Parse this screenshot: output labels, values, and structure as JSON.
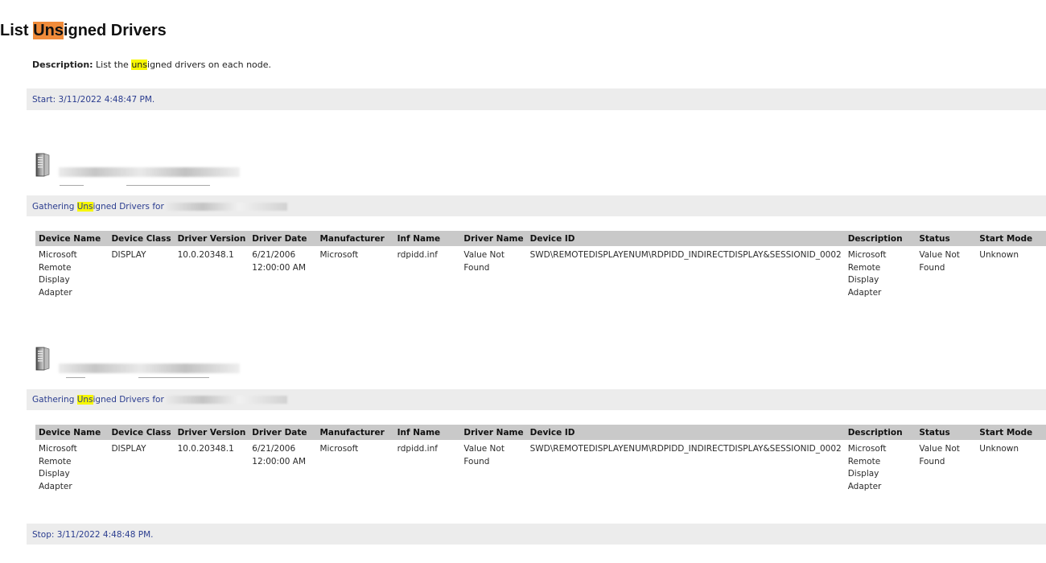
{
  "page": {
    "title_prefix": "List ",
    "title_highlight": "Uns",
    "title_suffix": "igned Drivers"
  },
  "description": {
    "label": "Description:",
    "text_prefix": " List the ",
    "text_highlight": "uns",
    "text_suffix": "igned drivers on each node."
  },
  "start": {
    "text": "Start: 3/11/2022 4:48:47 PM."
  },
  "stop": {
    "text": "Stop: 3/11/2022 4:48:48 PM."
  },
  "colors": {
    "title_highlight": "#f08b3a",
    "text_highlight": "#f7f700",
    "band_background": "#ececec",
    "band_text": "#2a3c8f",
    "table_header_background": "#c9c9c9"
  },
  "icons": {
    "node": "server-icon"
  },
  "table_headers": [
    "Device Name",
    "Device Class",
    "Driver Version",
    "Driver Date",
    "Manufacturer",
    "Inf Name",
    "Driver Name",
    "Device ID",
    "Description",
    "Status",
    "Start Mode"
  ],
  "nodes": [
    {
      "gathering_prefix": "Gathering ",
      "gathering_highlight": "Uns",
      "gathering_suffix": "igned Drivers for",
      "rows": [
        {
          "device_name": "Microsoft Remote Display Adapter",
          "device_class": "DISPLAY",
          "driver_version": "10.0.20348.1",
          "driver_date": "6/21/2006 12:00:00 AM",
          "manufacturer": "Microsoft",
          "inf_name": "rdpidd.inf",
          "driver_name": "Value Not Found",
          "device_id": "SWD\\REMOTEDISPLAYENUM\\RDPIDD_INDIRECTDISPLAY&SESSIONID_0002",
          "description": "Microsoft Remote Display Adapter",
          "status": "Value Not Found",
          "start_mode": "Unknown"
        }
      ]
    },
    {
      "gathering_prefix": "Gathering ",
      "gathering_highlight": "Uns",
      "gathering_suffix": "igned Drivers for",
      "rows": [
        {
          "device_name": "Microsoft Remote Display Adapter",
          "device_class": "DISPLAY",
          "driver_version": "10.0.20348.1",
          "driver_date": "6/21/2006 12:00:00 AM",
          "manufacturer": "Microsoft",
          "inf_name": "rdpidd.inf",
          "driver_name": "Value Not Found",
          "device_id": "SWD\\REMOTEDISPLAYENUM\\RDPIDD_INDIRECTDISPLAY&SESSIONID_0002",
          "description": "Microsoft Remote Display Adapter",
          "status": "Value Not Found",
          "start_mode": "Unknown"
        }
      ]
    }
  ]
}
